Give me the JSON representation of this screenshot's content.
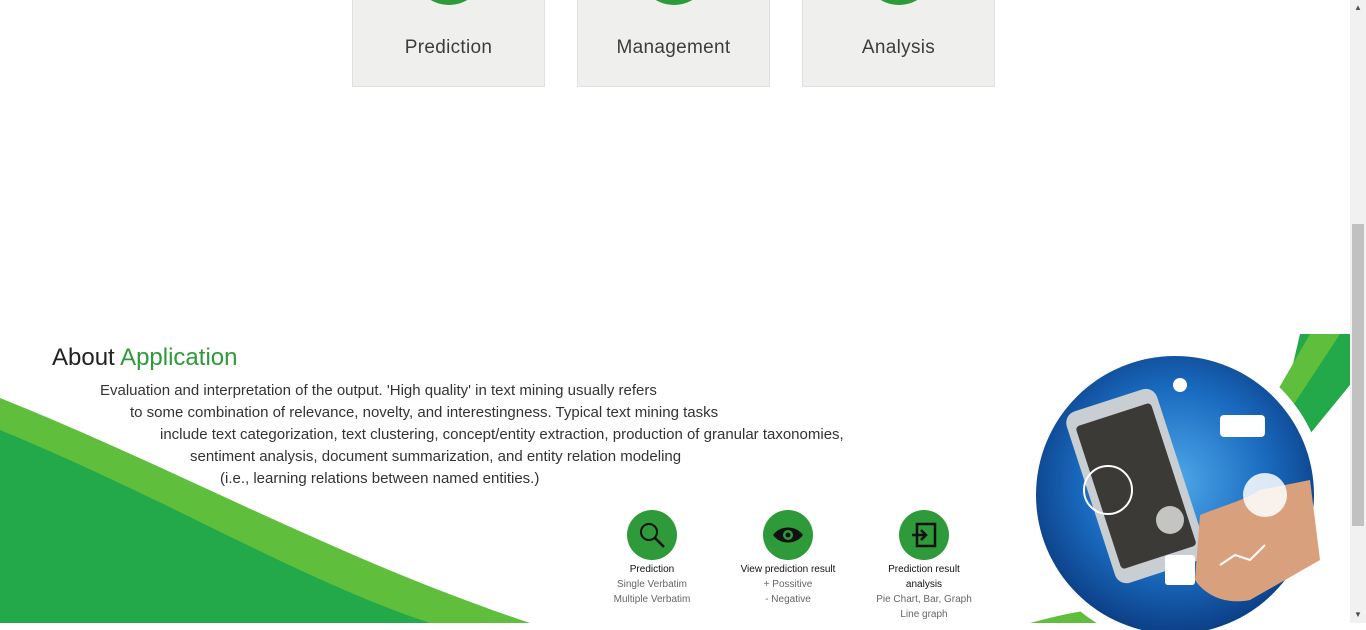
{
  "cards": [
    {
      "label": "Prediction",
      "icon": "circle-icon"
    },
    {
      "label": "Management",
      "icon": "circle-icon"
    },
    {
      "label": "Analysis",
      "icon": "circle-icon"
    }
  ],
  "about": {
    "title_prefix": "About",
    "title_accent": "Application",
    "lines": [
      "Evaluation and interpretation of the output. 'High quality' in text mining usually refers",
      "to some combination of relevance, novelty, and interestingness. Typical text mining tasks",
      "include text categorization, text clustering, concept/entity extraction, production of granular taxonomies,",
      "sentiment analysis, document summarization, and entity relation modeling",
      "(i.e., learning relations between named entities.)"
    ]
  },
  "features": [
    {
      "title": "Prediction",
      "lines": [
        "Single Verbatim",
        "Multiple Verbatim"
      ],
      "icon": "search-icon"
    },
    {
      "title": "View prediction result",
      "lines": [
        "+ Possitive",
        "- Negative"
      ],
      "icon": "eye-icon"
    },
    {
      "title": "Prediction result",
      "title2": "analysis",
      "lines": [
        "Pie Chart, Bar, Graph",
        "Line graph"
      ],
      "icon": "exit-icon"
    }
  ],
  "colors": {
    "accent": "#2e9a39",
    "light_green": "#6cc644",
    "card_bg": "#efefed"
  }
}
